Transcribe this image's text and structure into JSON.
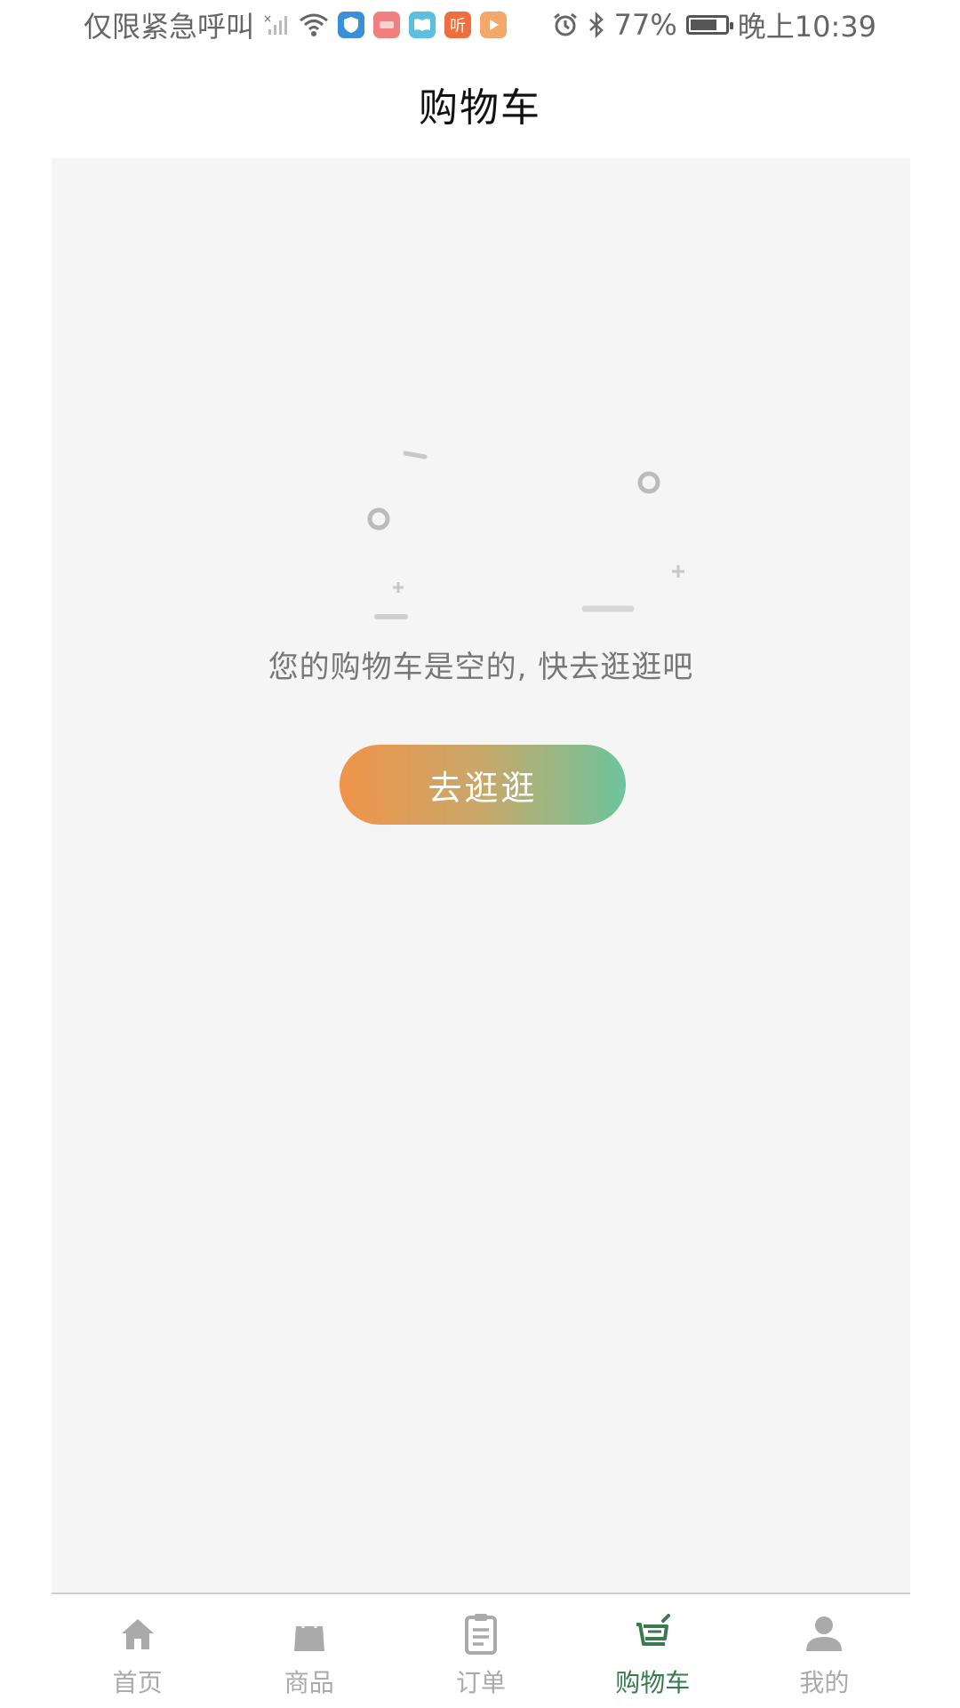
{
  "status_bar": {
    "carrier_text": "仅限紧急呼叫",
    "battery_percent": "77%",
    "time": "晚上10:39",
    "battery_level": 0.77,
    "icons": [
      "no-signal-icon",
      "wifi-icon",
      "shield-app-icon",
      "huawei-app-icon",
      "book-app-icon",
      "ting-app-icon",
      "play-app-icon",
      "alarm-icon",
      "bluetooth-icon",
      "battery-icon"
    ],
    "ting_label": "听"
  },
  "header": {
    "title": "购物车"
  },
  "empty_state": {
    "message": "您的购物车是空的, 快去逛逛吧",
    "button_label": "去逛逛",
    "button_gradient": [
      "#f0934a",
      "#6dc49d"
    ]
  },
  "tabbar": {
    "active_color": "#3a7a4f",
    "inactive_color": "#aaaaaa",
    "items": [
      {
        "label": "首页",
        "icon": "home-icon"
      },
      {
        "label": "商品",
        "icon": "shopping-bag-icon"
      },
      {
        "label": "订单",
        "icon": "clipboard-icon"
      },
      {
        "label": "购物车",
        "icon": "cart-icon",
        "active": true
      },
      {
        "label": "我的",
        "icon": "user-icon"
      }
    ]
  }
}
